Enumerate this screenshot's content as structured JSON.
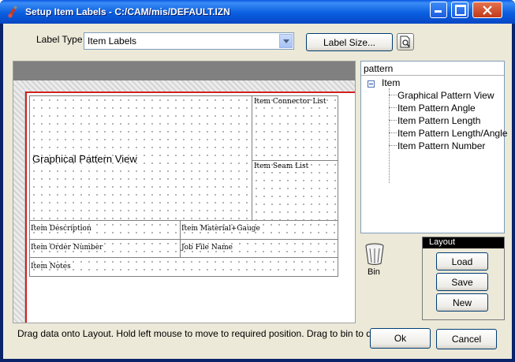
{
  "window": {
    "title": "Setup Item Labels - C:/CAM/mis/DEFAULT.IZN"
  },
  "toolbar": {
    "label_type_label": "Label Type",
    "label_type_value": "Item Labels",
    "label_size_button": "Label Size..."
  },
  "canvas": {
    "graphical_pattern_view": "Graphical Pattern View",
    "fields": {
      "item_connector_list": "Item Connector List",
      "item_seam_list": "Item Seam List",
      "item_description": "Item Description",
      "item_material_gauge": "Item Material+Gauge",
      "item_order_number": "Item Order Number",
      "job_file_name": "Job File Name",
      "item_notes": "Item Notes"
    }
  },
  "tree": {
    "header": "pattern",
    "root": "Item",
    "children": [
      "Graphical Pattern View",
      "Item Pattern Angle",
      "Item Pattern Length",
      "Item Pattern Length/Angle",
      "Item Pattern Number"
    ]
  },
  "bin": {
    "label": "Bin"
  },
  "layout": {
    "title": "Layout",
    "load": "Load",
    "save": "Save",
    "new": "New"
  },
  "status": {
    "hint": "Drag data onto Layout. Hold left mouse to move to required position. Drag to bin to delete."
  },
  "buttons": {
    "ok": "Ok",
    "cancel": "Cancel"
  },
  "colors": {
    "titlebar": "#0a5fe0",
    "margin_line": "#d32020",
    "layout_header": "#000000"
  }
}
